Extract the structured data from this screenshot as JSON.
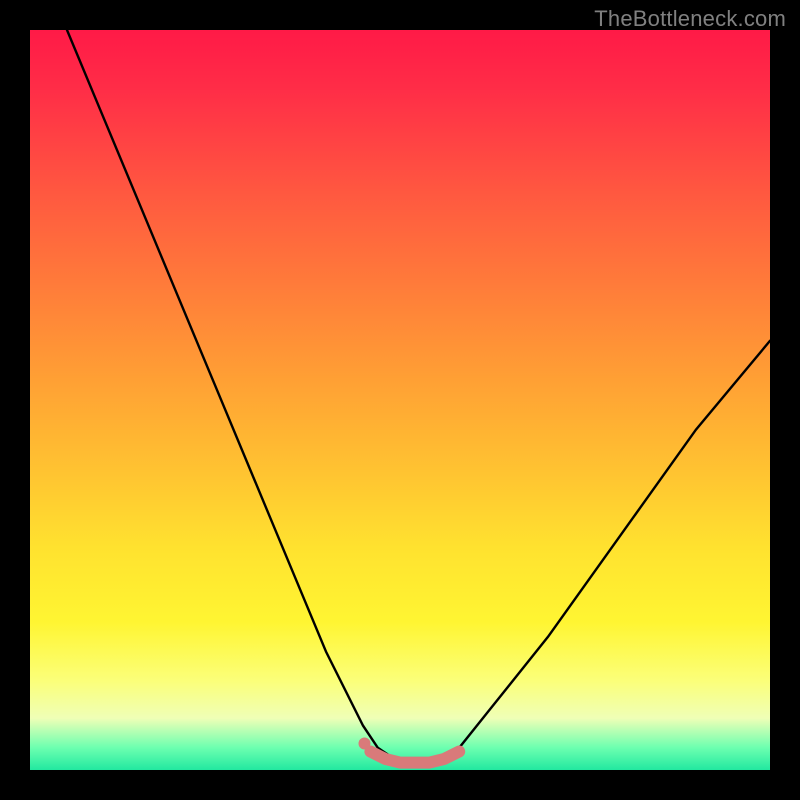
{
  "watermark": "TheBottleneck.com",
  "colors": {
    "page_bg": "#000000",
    "watermark": "#808080",
    "curve": "#000000",
    "marker": "#d97a7a"
  },
  "chart_data": {
    "type": "line",
    "title": "",
    "xlabel": "",
    "ylabel": "",
    "xlim": [
      0,
      100
    ],
    "ylim": [
      0,
      100
    ],
    "grid": false,
    "legend": false,
    "series": [
      {
        "name": "bottleneck-curve",
        "x": [
          5,
          10,
          15,
          20,
          25,
          30,
          35,
          40,
          45,
          47,
          50,
          53,
          56,
          58,
          62,
          70,
          80,
          90,
          100
        ],
        "values": [
          100,
          88,
          76,
          64,
          52,
          40,
          28,
          16,
          6,
          3,
          1,
          1,
          1,
          3,
          8,
          18,
          32,
          46,
          58
        ]
      },
      {
        "name": "optimal-range-marker",
        "x": [
          46,
          48,
          50,
          52,
          54,
          56,
          58
        ],
        "values": [
          2.5,
          1.5,
          1,
          1,
          1,
          1.5,
          2.5
        ]
      }
    ],
    "annotations": []
  }
}
